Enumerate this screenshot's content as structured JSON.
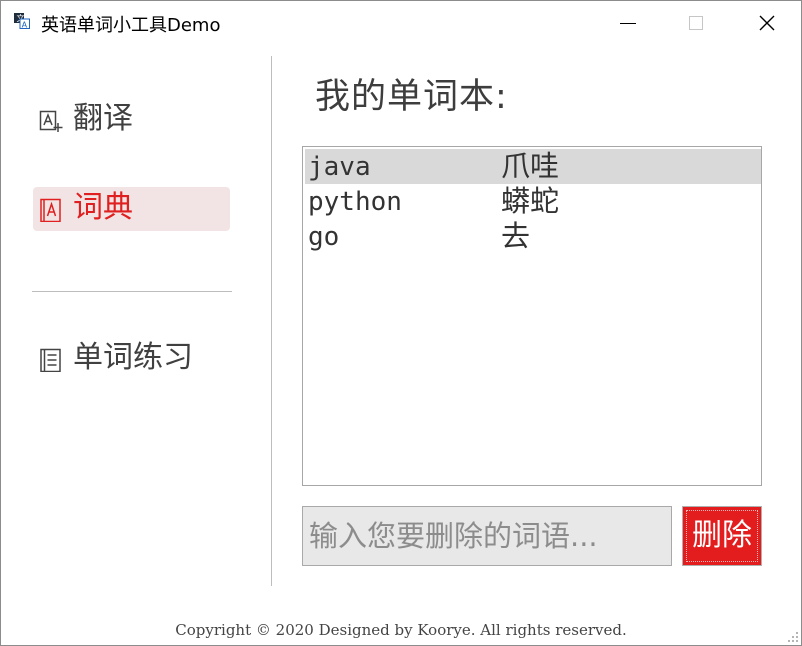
{
  "window": {
    "title": "英语单词小工具Demo"
  },
  "sidebar": {
    "items": [
      {
        "label": "翻译",
        "icon": "translate-icon",
        "active": false
      },
      {
        "label": "词典",
        "icon": "dictionary-icon",
        "active": true
      },
      {
        "label": "单词练习",
        "icon": "notebook-icon",
        "active": false
      }
    ]
  },
  "main": {
    "title": "我的单词本:",
    "words": [
      {
        "en": "java",
        "zh": "爪哇",
        "selected": true
      },
      {
        "en": "python",
        "zh": "蟒蛇",
        "selected": false
      },
      {
        "en": "go",
        "zh": "去",
        "selected": false
      }
    ],
    "delete_input": {
      "value": "",
      "placeholder": "输入您要删除的词语..."
    },
    "delete_button": "删除"
  },
  "footer": "Copyright © 2020 Designed by Koorye. All rights reserved.",
  "colors": {
    "accent": "#e31d1d",
    "selected_row": "#d9d9d9",
    "active_nav_bg": "#f2e4e4"
  }
}
